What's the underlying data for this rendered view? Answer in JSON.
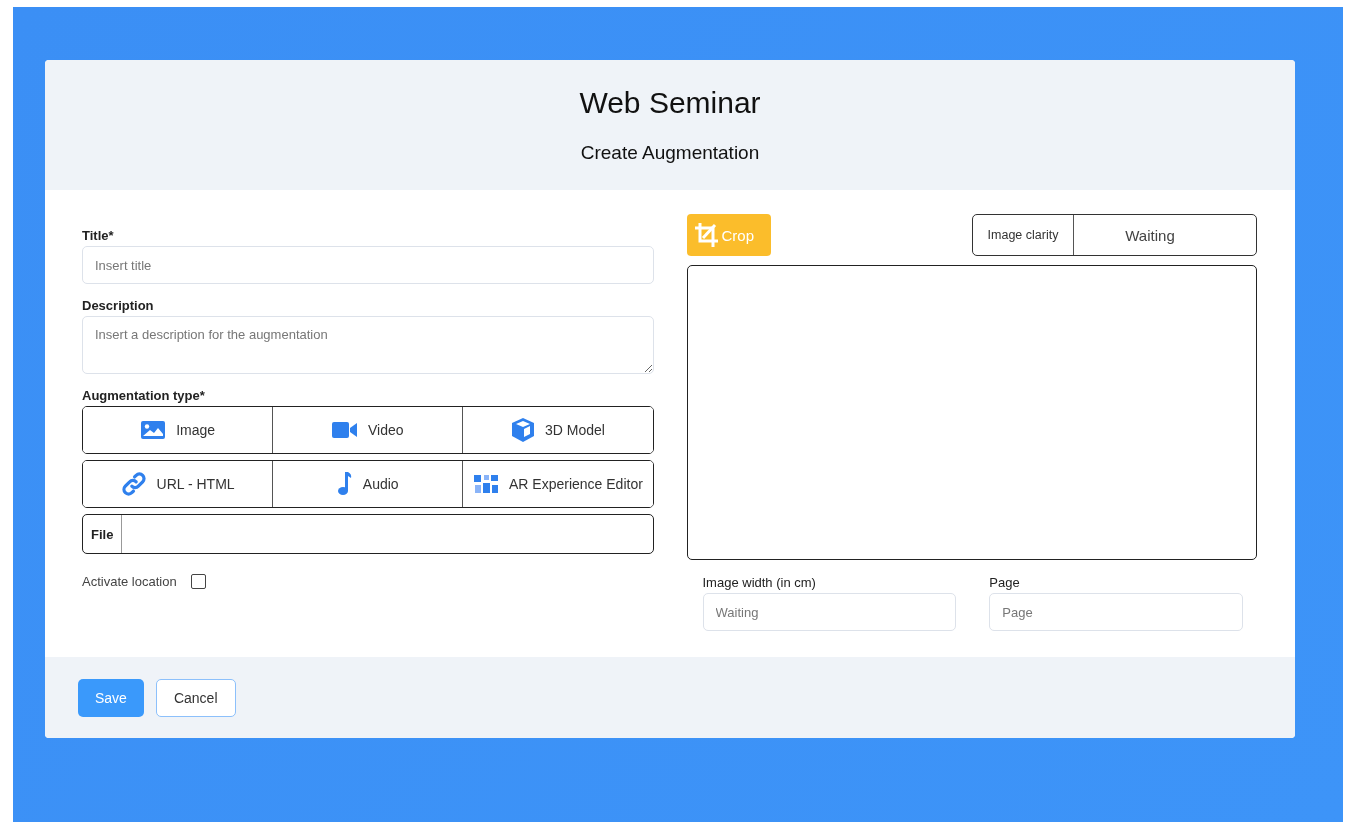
{
  "header": {
    "title": "Web Seminar",
    "subtitle": "Create Augmentation"
  },
  "form": {
    "title": {
      "label": "Title*",
      "placeholder": "Insert title"
    },
    "description": {
      "label": "Description",
      "placeholder": "Insert a description for the augmentation"
    },
    "augmentation_type": {
      "label": "Augmentation type*",
      "rows": [
        [
          {
            "label": "Image",
            "kind": "image"
          },
          {
            "label": "Video",
            "kind": "video"
          },
          {
            "label": "3D Model",
            "kind": "cube"
          }
        ],
        [
          {
            "label": "URL - HTML",
            "kind": "link"
          },
          {
            "label": "Audio",
            "kind": "music"
          },
          {
            "label": "AR Experience Editor",
            "kind": "editor"
          }
        ]
      ]
    },
    "file": {
      "label": "File"
    },
    "activate_location": {
      "label": "Activate location",
      "checked": false
    }
  },
  "preview": {
    "crop_button": "Crop",
    "image_clarity": {
      "label": "Image clarity",
      "value": "Waiting"
    },
    "image_width": {
      "label": "Image width (in cm)",
      "placeholder": "Waiting"
    },
    "page": {
      "label": "Page",
      "placeholder": "Page"
    }
  },
  "footer": {
    "buttons": [
      {
        "label": "Save",
        "kind": "primary"
      },
      {
        "label": "Cancel",
        "kind": "secondary"
      }
    ]
  }
}
